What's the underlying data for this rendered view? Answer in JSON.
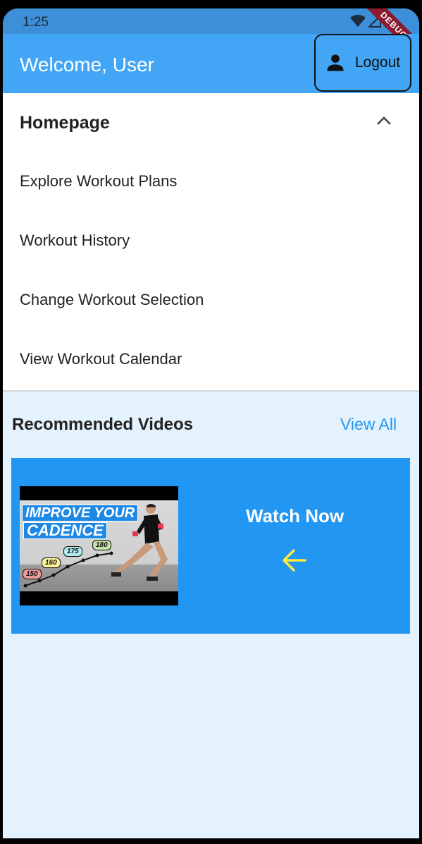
{
  "status_bar": {
    "time": "1:25",
    "debug_label": "DEBUG"
  },
  "app_bar": {
    "title": "Welcome, User",
    "logout_label": "Logout"
  },
  "menu": {
    "title": "Homepage",
    "expanded": true,
    "items": [
      {
        "label": "Explore Workout Plans"
      },
      {
        "label": "Workout History"
      },
      {
        "label": "Change Workout Selection"
      },
      {
        "label": "View Workout Calendar"
      }
    ]
  },
  "recommended": {
    "title": "Recommended Videos",
    "view_all_label": "View All",
    "video": {
      "thumbnail_line1": "IMPROVE YOUR",
      "thumbnail_line2": "CADENCE",
      "cadence_values": [
        "150",
        "160",
        "175",
        "180"
      ],
      "watch_label": "Watch Now",
      "arrow_icon": "arrow-left-icon"
    }
  },
  "colors": {
    "app_bar": "#42a5f5",
    "accent": "#2196f3",
    "background": "#e3f2fd",
    "arrow": "#ffeb3b"
  }
}
